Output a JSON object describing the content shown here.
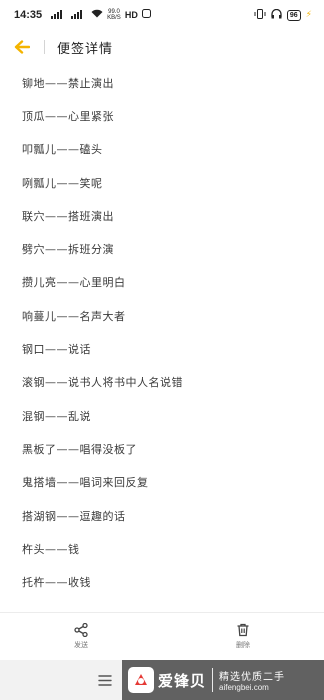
{
  "status_bar": {
    "time": "14:35",
    "signal_1": "5G",
    "signal_2": "4G",
    "net_speed_value": "99.0",
    "net_speed_unit": "KB/S",
    "hd": "HD",
    "battery": "96"
  },
  "header": {
    "title": "便签详情"
  },
  "note": {
    "lines": [
      "铆地——禁止演出",
      "顶瓜——心里紧张",
      "叩瓢儿——磕头",
      "咧瓢儿——笑呢",
      "联穴——搭班演出",
      "劈穴——拆班分演",
      "攒儿亮——心里明白",
      "响蔓儿——名声大者",
      "钢口——说话",
      "滚钢——说书人将书中人名说错",
      "混钢——乱说",
      "黑板了——唱得没板了",
      "鬼搭墙——唱词来回反复",
      "搭湖钢——逗趣的话",
      "杵头——钱",
      "托杵——收钱"
    ]
  },
  "toolbar": {
    "share_label": "发送",
    "delete_label": "删除"
  },
  "watermark": {
    "brand": "爱锋贝",
    "slogan": "精选优质二手",
    "url": "aifengbei.com"
  },
  "colors": {
    "accent": "#f4b400",
    "text": "#3a3a3a"
  }
}
